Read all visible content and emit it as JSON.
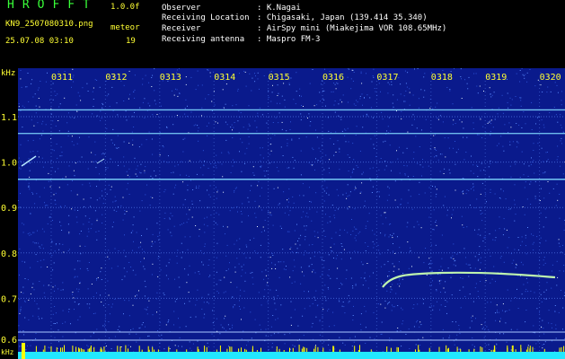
{
  "header": {
    "app_title": "HROFFT",
    "version": "1.0.0f",
    "filename": "KN9_2507080310.png",
    "mode": "meteor",
    "datetime": "25.07.08 03:10",
    "count": "19",
    "info": [
      {
        "label": "Observer",
        "value": ": K.Nagai"
      },
      {
        "label": "Receiving Location",
        "value": ": Chigasaki, Japan (139.414 35.340)"
      },
      {
        "label": "Receiver",
        "value": ": AirSpy mini (Miakejima VOR 108.65MHz)"
      },
      {
        "label": "Receiving antenna",
        "value": ": Maspro FM-3"
      }
    ]
  },
  "plot": {
    "y_unit": "kHz",
    "y_unit_bottom": "kHz",
    "y_ticks": [
      "1.1",
      "1.0",
      "0.9",
      "0.8",
      "0.7",
      "0.6"
    ],
    "x_ticks": [
      "0311",
      "0312",
      "0313",
      "0314",
      "0315",
      "0316",
      "0317",
      "0318",
      "0319",
      "0320"
    ],
    "colors": {
      "background": "#0a1a8c",
      "grid": "#4a6fe0",
      "carrier": "#7fd8ff",
      "meteor": "#c8ffb0",
      "tick_text": "#ffff33",
      "bottom_bar": "#22e8ff",
      "spikes": "#ffff00"
    }
  }
}
